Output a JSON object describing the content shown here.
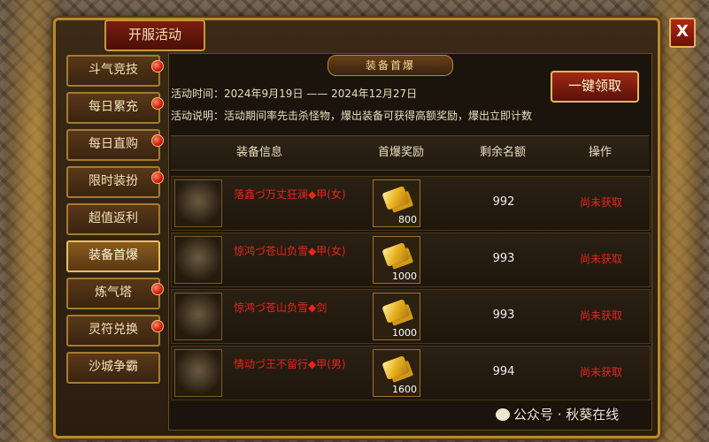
{
  "window": {
    "tab_title": "开服活动",
    "close_label": "X"
  },
  "sidebar": {
    "items": [
      {
        "label": "斗气竞技",
        "badge": true,
        "active": false
      },
      {
        "label": "每日累充",
        "badge": true,
        "active": false
      },
      {
        "label": "每日直购",
        "badge": true,
        "active": false
      },
      {
        "label": "限时装扮",
        "badge": true,
        "active": false
      },
      {
        "label": "超值返利",
        "badge": false,
        "active": false
      },
      {
        "label": "装备首爆",
        "badge": false,
        "active": true
      },
      {
        "label": "炼气塔",
        "badge": true,
        "active": false
      },
      {
        "label": "灵符兑换",
        "badge": true,
        "active": false
      },
      {
        "label": "沙城争霸",
        "badge": false,
        "active": false
      }
    ]
  },
  "panel": {
    "banner": "装备首爆",
    "time_text": "活动时间：2024年9月19日 —— 2024年12月27日",
    "desc_text": "活动说明：活动期间率先击杀怪物，爆出装备可获得高额奖励，爆出立即计数",
    "claim_all_label": "一键领取"
  },
  "table": {
    "headers": [
      "装备信息",
      "首爆奖励",
      "剩余名额",
      "操作"
    ],
    "rows": [
      {
        "name": "落鑫づ万丈狂澜◆甲(女)",
        "reward": "800",
        "remaining": "992",
        "status": "尚未获取"
      },
      {
        "name": "惊鸿づ苍山负雪◆甲(女)",
        "reward": "1000",
        "remaining": "993",
        "status": "尚未获取"
      },
      {
        "name": "惊鸿づ苍山负雪◆剑",
        "reward": "1000",
        "remaining": "993",
        "status": "尚未获取"
      },
      {
        "name": "情动づ王不留行◆甲(男)",
        "reward": "1600",
        "remaining": "994",
        "status": "尚未获取"
      }
    ]
  },
  "watermark": "公众号 · 秋葵在线"
}
